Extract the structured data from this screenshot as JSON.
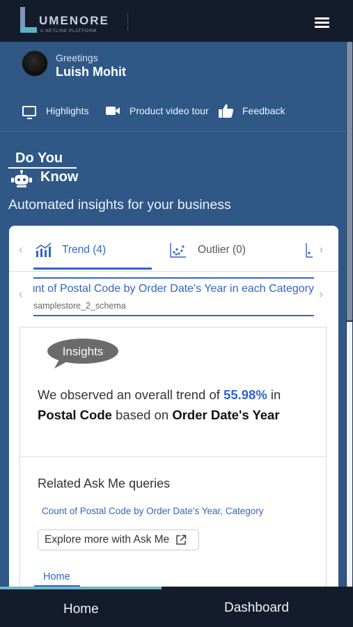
{
  "brand": {
    "name": "UMENORE",
    "tagline": "A NETLINK PLATFORM"
  },
  "profile": {
    "greeting": "Greetings",
    "name": "Luish Mohit"
  },
  "actions": [
    {
      "label": "Highlights",
      "icon": "monitor-icon"
    },
    {
      "label": "Product video tour",
      "icon": "video-camera-icon"
    },
    {
      "label": "Feedback",
      "icon": "thumbs-up-icon"
    }
  ],
  "dyk": {
    "line1": "Do You",
    "line2": "Know",
    "subtitle": "Automated insights for your business"
  },
  "tabs": [
    {
      "label": "Trend (4)",
      "active": true
    },
    {
      "label": "Outlier (0)",
      "active": false
    }
  ],
  "insight_card": {
    "title": "Count of Postal Code by Order Date's Year in each Category",
    "schema": "samplestore_2_schema",
    "badge": "Insights",
    "text_prefix": "We observed an overall trend of ",
    "percentage": "55.98%",
    "text_mid1": " in",
    "measure": "Postal Code",
    "text_mid2": " based on ",
    "dimension": "Order Date's Year",
    "related_title": "Related Ask Me queries",
    "related_link": "Count of Postal Code by Order Date's Year, Category",
    "explore_label": "Explore more with Ask Me",
    "home_link": "Home"
  },
  "bottom_nav": [
    {
      "label": "Home"
    },
    {
      "label": "Dashboard"
    }
  ],
  "colors": {
    "accent": "#3165c8",
    "header": "#141c2c",
    "background": "#2f5887",
    "indicator": "#6fb8c9"
  }
}
